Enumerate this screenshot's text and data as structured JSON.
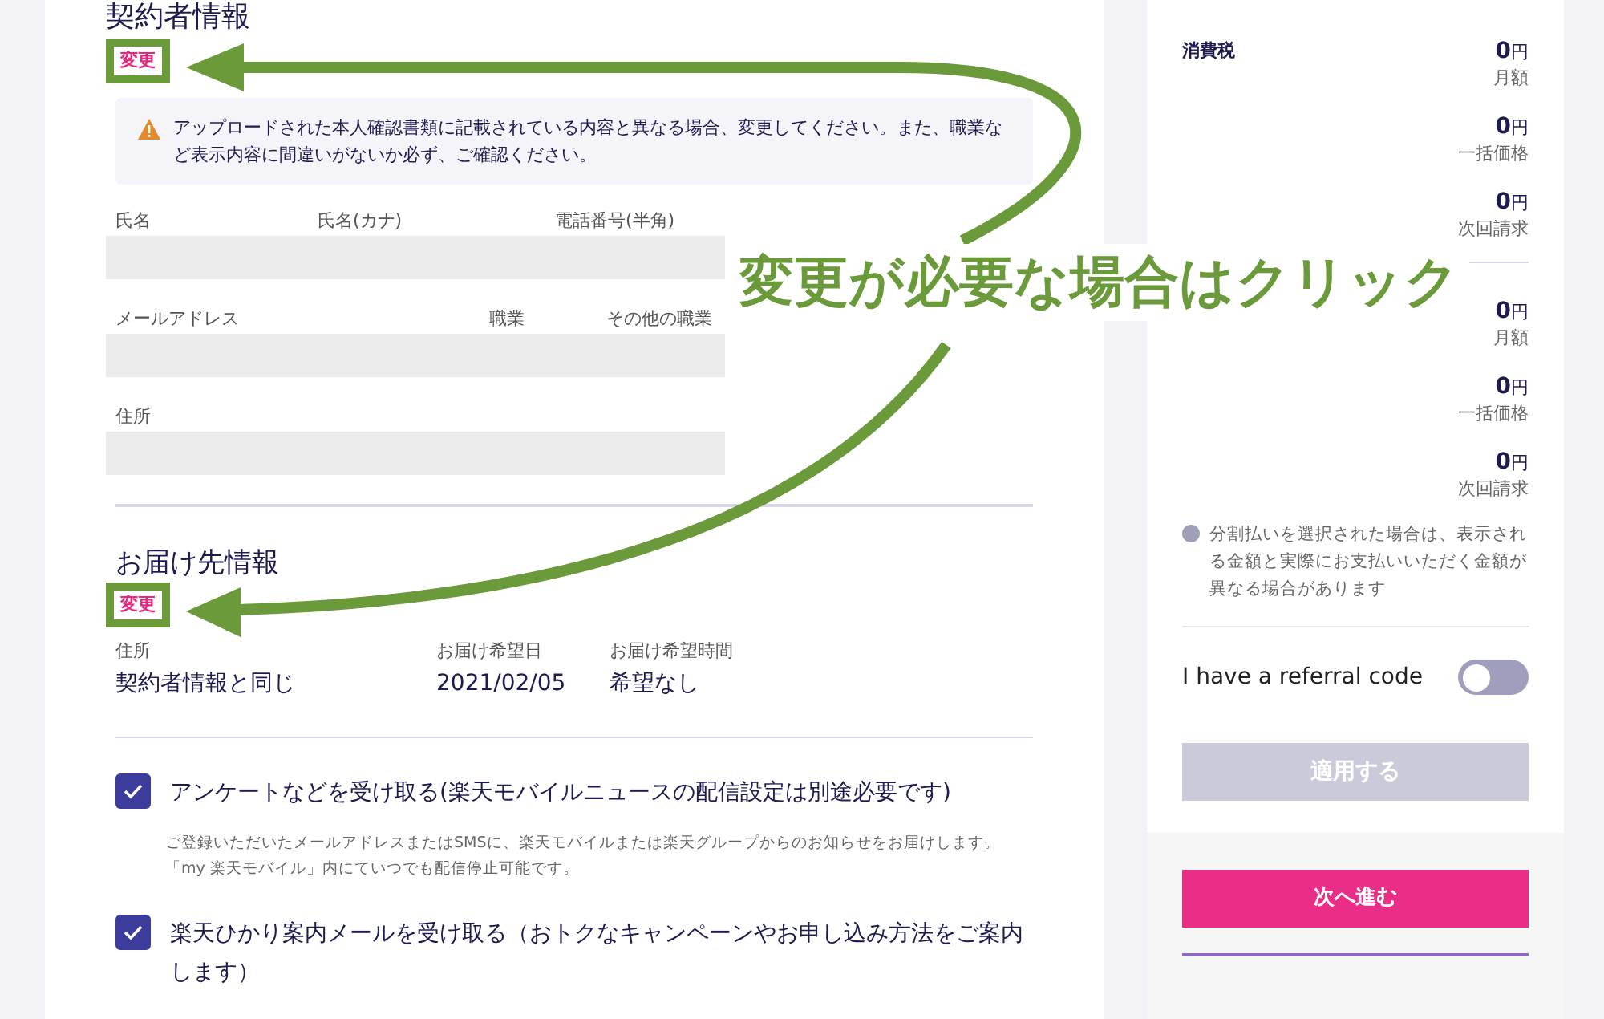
{
  "contract": {
    "title": "契約者情報",
    "change_link": "変更",
    "warning": "アップロードされた本人確認書類に記載されている内容と異なる場合、変更してください。また、職業など表示内容に間違いがないか必ず、ご確認ください。",
    "field_rows": [
      [
        "氏名",
        "氏名(カナ)",
        "電話番号(半角)"
      ],
      [
        "メールアドレス",
        "職業",
        "その他の職業"
      ],
      [
        "住所"
      ]
    ]
  },
  "delivery": {
    "title": "お届け先情報",
    "change_link": "変更",
    "items": [
      {
        "label": "住所",
        "value": "契約者情報と同じ"
      },
      {
        "label": "お届け希望日",
        "value": "2021/02/05"
      },
      {
        "label": "お届け希望時間",
        "value": "希望なし"
      }
    ]
  },
  "options": [
    {
      "label": "アンケートなどを受け取る(楽天モバイルニュースの配信設定は別途必要です)",
      "checked": true,
      "note": "ご登録いただいたメールアドレスまたはSMSに、楽天モバイルまたは楽天グループからのお知らせをお届けします。「my 楽天モバイル」内にていつでも配信停止可能です。"
    },
    {
      "label": "楽天ひかり案内メールを受け取る（おトクなキャンペーンやお申し込み方法をご案内します）",
      "checked": true
    }
  ],
  "summary": {
    "tax_label": "消費税",
    "groups": [
      [
        {
          "amount": "**0**円",
          "caption": "月額"
        },
        {
          "amount": "**0**円",
          "caption": "一括価格"
        },
        {
          "amount": "**0**円",
          "caption": "次回請求"
        }
      ],
      [
        {
          "amount": "**0**円",
          "caption": "月額"
        },
        {
          "amount": "**0**円",
          "caption": "一括価格"
        },
        {
          "amount": "**0**円",
          "caption": "次回請求"
        }
      ]
    ],
    "note": "分割払いを選択された場合は、表示される金額と実際にお支払いいただく金額が異なる場合があります",
    "referral": {
      "label": "I have a referral code",
      "on": false
    },
    "apply_button": {
      "label": "適用する",
      "disabled": true
    },
    "next_button": "次へ進む"
  },
  "annotation": {
    "text": "変更が必要な場合はクリック"
  }
}
